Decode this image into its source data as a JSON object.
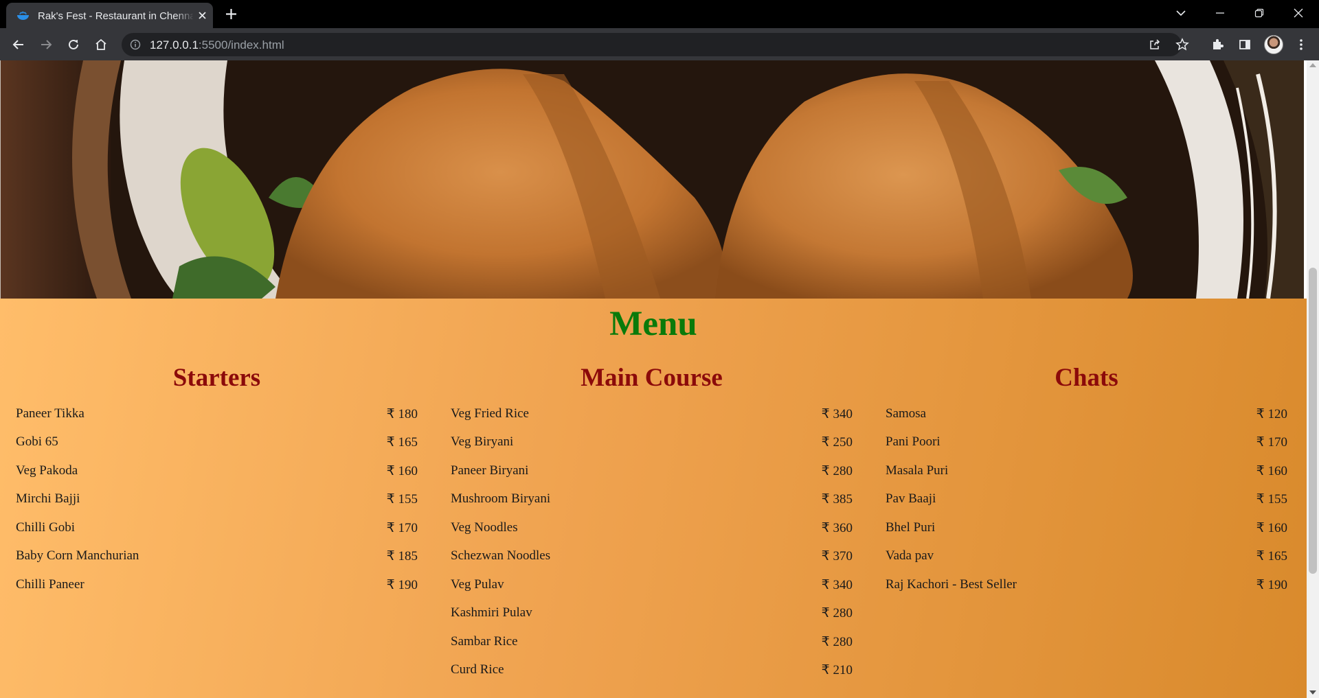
{
  "browser": {
    "tab_title": "Rak's Fest - Restaurant in Chennai",
    "url_host": "127.0.0.1",
    "url_rest": ":5500/index.html"
  },
  "menu": {
    "title": "Menu",
    "columns": [
      {
        "title": "Starters",
        "items": [
          {
            "name": "Paneer Tikka",
            "price": "₹ 180"
          },
          {
            "name": "Gobi 65",
            "price": "₹ 165"
          },
          {
            "name": "Veg Pakoda",
            "price": "₹ 160"
          },
          {
            "name": "Mirchi Bajji",
            "price": "₹ 155"
          },
          {
            "name": "Chilli Gobi",
            "price": "₹ 170"
          },
          {
            "name": "Baby Corn Manchurian",
            "price": "₹ 185"
          },
          {
            "name": "Chilli Paneer",
            "price": "₹ 190"
          }
        ]
      },
      {
        "title": "Main Course",
        "items": [
          {
            "name": "Veg Fried Rice",
            "price": "₹ 340"
          },
          {
            "name": "Veg Biryani",
            "price": "₹ 250"
          },
          {
            "name": "Paneer Biryani",
            "price": "₹ 280"
          },
          {
            "name": "Mushroom Biryani",
            "price": "₹ 385"
          },
          {
            "name": "Veg Noodles",
            "price": "₹ 360"
          },
          {
            "name": "Schezwan Noodles",
            "price": "₹ 370"
          },
          {
            "name": "Veg Pulav",
            "price": "₹ 340"
          },
          {
            "name": "Kashmiri Pulav",
            "price": "₹ 280"
          },
          {
            "name": "Sambar Rice",
            "price": "₹ 280"
          },
          {
            "name": "Curd Rice",
            "price": "₹ 210"
          }
        ]
      },
      {
        "title": "Chats",
        "items": [
          {
            "name": "Samosa",
            "price": "₹ 120"
          },
          {
            "name": "Pani Poori",
            "price": "₹ 170"
          },
          {
            "name": "Masala Puri",
            "price": "₹ 160"
          },
          {
            "name": "Pav Baaji",
            "price": "₹ 155"
          },
          {
            "name": "Bhel Puri",
            "price": "₹ 160"
          },
          {
            "name": "Vada pav",
            "price": "₹ 165"
          },
          {
            "name": "Raj Kachori - Best Seller",
            "price": "₹ 190"
          }
        ]
      }
    ]
  },
  "colors": {
    "menu_title": "#0a7a0a",
    "column_title": "#8b0a0a",
    "menu_bg_start": "#ffbd6a",
    "menu_bg_end": "#d98a2c"
  },
  "icons": [
    "restaurant-favicon",
    "close-icon",
    "plus-icon",
    "chevron-down-icon",
    "minimize-icon",
    "restore-icon",
    "window-close-icon",
    "back-arrow-icon",
    "forward-arrow-icon",
    "reload-icon",
    "home-icon",
    "info-icon",
    "share-icon",
    "star-icon",
    "extensions-icon",
    "side-panel-icon",
    "more-vert-icon"
  ]
}
